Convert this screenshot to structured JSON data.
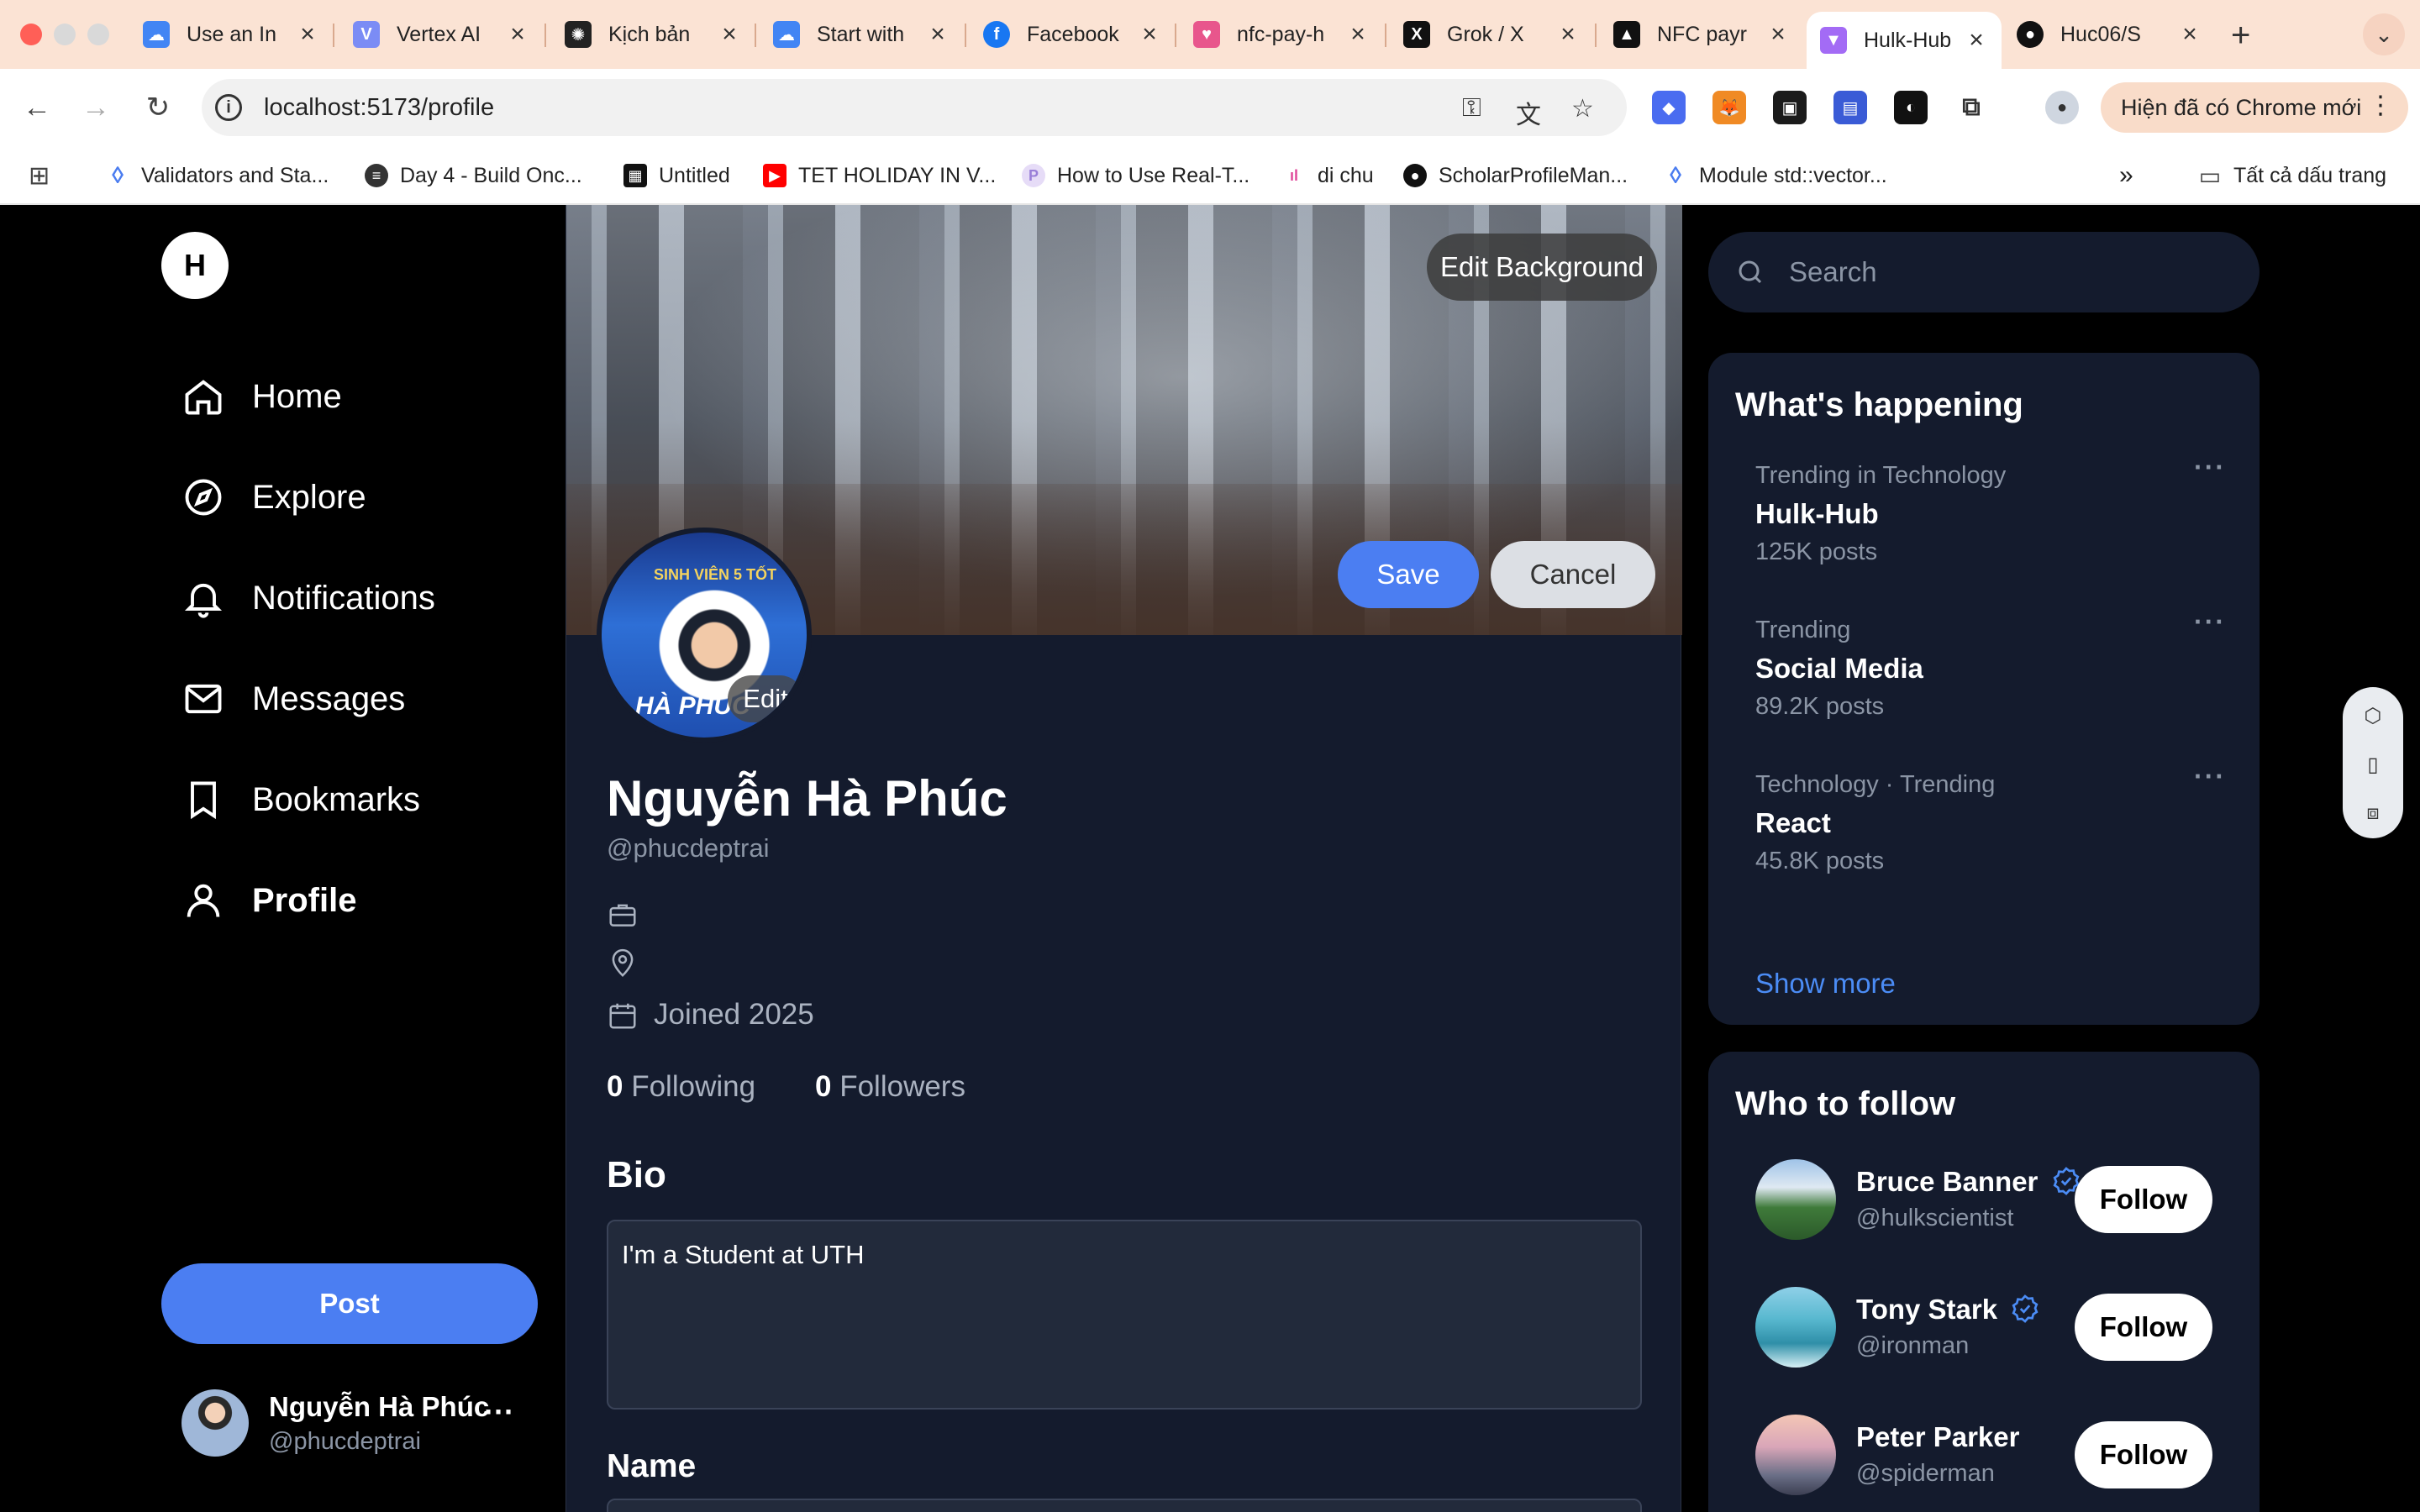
{
  "browser": {
    "tabs": [
      {
        "title": "Use an In",
        "icon": "google-cloud-icon",
        "color": "#4285f4"
      },
      {
        "title": "Vertex AI",
        "icon": "vertex-ai-icon",
        "color": "#7b8cf5"
      },
      {
        "title": "Kịch bản",
        "icon": "openai-icon",
        "color": "#222222"
      },
      {
        "title": "Start with",
        "icon": "google-cloud-icon",
        "color": "#4285f4"
      },
      {
        "title": "Facebook",
        "icon": "facebook-icon",
        "color": "#1877f2"
      },
      {
        "title": "nfc-pay-h",
        "icon": "heart-app-icon",
        "color": "#e8568c"
      },
      {
        "title": "Grok / X",
        "icon": "x-icon",
        "color": "#111111"
      },
      {
        "title": "NFC payr",
        "icon": "vercel-icon",
        "color": "#111111"
      },
      {
        "title": "Hulk-Hub",
        "icon": "vite-icon",
        "color": "#a36bf5"
      },
      {
        "title": "Huc06/S",
        "icon": "github-icon",
        "color": "#111111"
      }
    ],
    "url": "localhost:5173/profile",
    "chrome_update": "Hiện đã có Chrome mới",
    "bookmarks": [
      {
        "label": "Validators and Sta...",
        "icon": "drop-icon",
        "color": "#4a7cf0"
      },
      {
        "label": "Day 4 - Build Onc...",
        "icon": "badge-icon",
        "color": "#333333"
      },
      {
        "label": "Untitled",
        "icon": "grid-app-icon",
        "color": "#111111"
      },
      {
        "label": "TET HOLIDAY IN V...",
        "icon": "youtube-icon",
        "color": "#ff0000"
      },
      {
        "label": "How to Use Real-T...",
        "icon": "p-icon",
        "color": "#c9b7f0"
      },
      {
        "label": "di chu",
        "icon": "brand-icon",
        "color": "#e04a9c"
      },
      {
        "label": "ScholarProfileMan...",
        "icon": "github-icon",
        "color": "#111111"
      },
      {
        "label": "Module std::vector...",
        "icon": "drop-icon",
        "color": "#4a7cf0"
      }
    ],
    "all_bookmarks": "Tất cả dấu trang"
  },
  "sidebar": {
    "logo": "H",
    "nav": [
      {
        "label": "Home",
        "icon": "home-icon"
      },
      {
        "label": "Explore",
        "icon": "explore-icon"
      },
      {
        "label": "Notifications",
        "icon": "bell-icon"
      },
      {
        "label": "Messages",
        "icon": "mail-icon"
      },
      {
        "label": "Bookmarks",
        "icon": "bookmark-icon"
      },
      {
        "label": "Profile",
        "icon": "user-icon"
      }
    ],
    "post_label": "Post",
    "account": {
      "name": "Nguyễn Hà Phúc",
      "handle": "@phucdeptrai"
    }
  },
  "profile": {
    "edit_background": "Edit Background",
    "save": "Save",
    "cancel": "Cancel",
    "avatar_edit": "Edit",
    "avatar_text_top": "SINH VIÊN 5 TỐT",
    "avatar_text_bottom": "HÀ PHÚC",
    "name": "Nguyễn Hà Phúc",
    "handle": "@phucdeptrai",
    "joined": "Joined 2025",
    "following_count": "0",
    "following_label": "Following",
    "followers_count": "0",
    "followers_label": "Followers",
    "bio_label": "Bio",
    "bio_value": "I'm a Student at UTH",
    "name_label": "Name"
  },
  "right": {
    "search_placeholder": "Search",
    "happening_title": "What's happening",
    "trends": [
      {
        "context": "Trending in Technology",
        "title": "Hulk-Hub",
        "count": "125K posts"
      },
      {
        "context": "Trending",
        "title": "Social Media",
        "count": "89.2K posts"
      },
      {
        "context": "Technology · Trending",
        "title": "React",
        "count": "45.8K posts"
      }
    ],
    "show_more": "Show more",
    "who_title": "Who to follow",
    "suggestions": [
      {
        "name": "Bruce Banner",
        "handle": "@hulkscientist",
        "verified": true,
        "follow": "Follow"
      },
      {
        "name": "Tony Stark",
        "handle": "@ironman",
        "verified": true,
        "follow": "Follow"
      },
      {
        "name": "Peter Parker",
        "handle": "@spiderman",
        "verified": false,
        "follow": "Follow"
      }
    ]
  },
  "colors": {
    "accent": "#4b7ef2",
    "link": "#4b8cf5",
    "panel": "#141b2d",
    "background": "#000000"
  }
}
